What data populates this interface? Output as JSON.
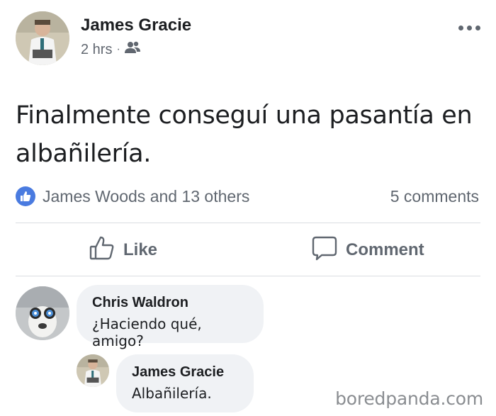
{
  "post": {
    "author": "James Gracie",
    "time": "2 hrs",
    "separator": "·",
    "audience_icon": "friends-icon",
    "text": "Finalmente conseguí una pasantía en albañilería.",
    "reactions": {
      "icon": "like-icon",
      "summary": "James Woods and 13 others"
    },
    "comments_count": "5 comments",
    "actions": {
      "like_label": "Like",
      "comment_label": "Comment"
    }
  },
  "comments": [
    {
      "author": "Chris Waldron",
      "text": "¿Haciendo qué, amigo?"
    },
    {
      "author": "James Gracie",
      "text": "Albañilería."
    }
  ],
  "watermark": "boredpanda.com",
  "colors": {
    "like_blue": "#4a7be0",
    "text_secondary": "#606770",
    "bubble_bg": "#f0f2f5"
  }
}
